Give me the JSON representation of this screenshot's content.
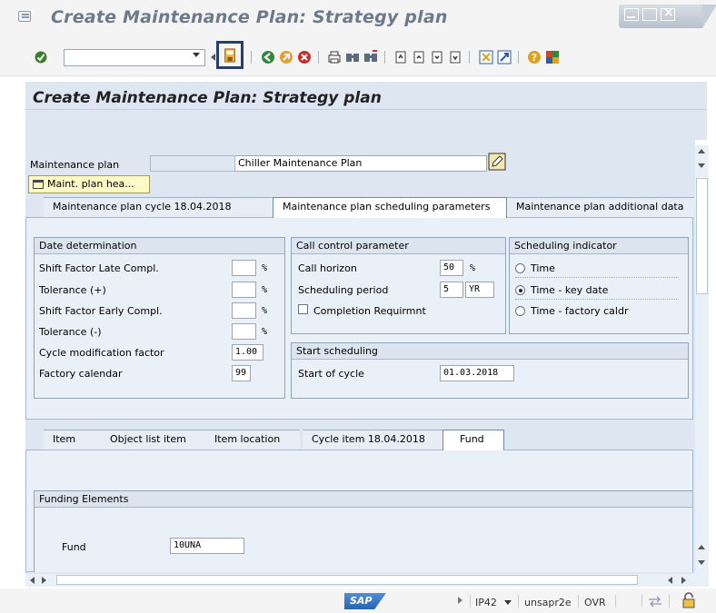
{
  "window": {
    "title": "Create Maintenance Plan: Strategy plan"
  },
  "toolbar": {
    "command_value": "",
    "icons": [
      "enter-icon",
      "save-icon",
      "back-icon",
      "exit-icon",
      "cancel-icon",
      "print-icon",
      "find-icon",
      "find-next-icon",
      "first-page-icon",
      "prev-page-icon",
      "next-page-icon",
      "last-page-icon",
      "new-session-icon",
      "shortcut-icon",
      "help-icon",
      "customize-layout-icon"
    ]
  },
  "screen": {
    "title": "Create Maintenance Plan: Strategy plan"
  },
  "header": {
    "plan_label": "Maintenance plan",
    "plan_number": "",
    "plan_description": "Chiller Maintenance Plan",
    "header_button": "Maint. plan hea..."
  },
  "tabs_top": [
    {
      "label": "Maintenance plan cycle 18.04.2018",
      "active": false
    },
    {
      "label": "Maintenance plan scheduling parameters",
      "active": true
    },
    {
      "label": "Maintenance plan additional data",
      "active": false
    }
  ],
  "date_determination": {
    "title": "Date determination",
    "rows": [
      {
        "label": "Shift Factor Late Compl.",
        "value": "",
        "unit": "%"
      },
      {
        "label": "Tolerance (+)",
        "value": "",
        "unit": "%"
      },
      {
        "label": "Shift Factor Early Compl.",
        "value": "",
        "unit": "%"
      },
      {
        "label": "Tolerance (-)",
        "value": "",
        "unit": "%"
      },
      {
        "label": "Cycle modification factor",
        "value": "1.00",
        "unit": ""
      },
      {
        "label": "Factory calendar",
        "value": "99",
        "unit": ""
      }
    ]
  },
  "call_control": {
    "title": "Call control parameter",
    "call_horizon_label": "Call horizon",
    "call_horizon_value": "50",
    "call_horizon_unit": "%",
    "scheduling_period_label": "Scheduling period",
    "scheduling_period_value": "5",
    "scheduling_period_unit": "YR",
    "completion_label": "Completion Requirmnt",
    "completion_checked": false
  },
  "scheduling_indicator": {
    "title": "Scheduling indicator",
    "options": [
      {
        "label": "Time",
        "selected": false
      },
      {
        "label": "Time - key date",
        "selected": true
      },
      {
        "label": "Time - factory caldr",
        "selected": false
      }
    ]
  },
  "start_scheduling": {
    "title": "Start scheduling",
    "start_label": "Start of cycle",
    "start_value": "01.03.2018"
  },
  "tabs_bottom": [
    {
      "label": "Item",
      "active": false
    },
    {
      "label": "Object list item",
      "active": false
    },
    {
      "label": "Item location",
      "active": false
    },
    {
      "label": "Cycle item 18.04.2018",
      "active": false
    },
    {
      "label": "Fund",
      "active": true
    }
  ],
  "funding": {
    "title": "Funding Elements",
    "fund_label": "Fund",
    "fund_value": "10UNA"
  },
  "statusbar": {
    "logo": "SAP",
    "system": "IP42",
    "server": "unsapr2e",
    "mode": "OVR"
  }
}
